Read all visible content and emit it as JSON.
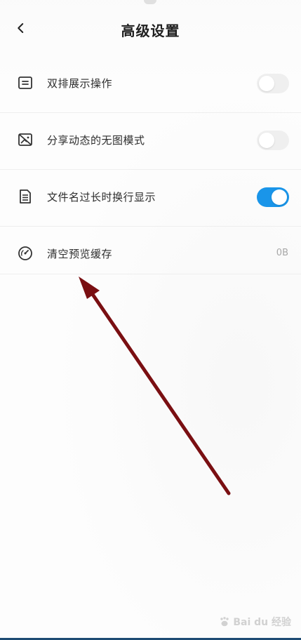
{
  "header": {
    "title": "高级设置",
    "back_icon": "chevron-left-icon"
  },
  "settings": [
    {
      "id": "dual-row-actions",
      "label": "双排展示操作",
      "icon": "list-box-icon",
      "control": "toggle",
      "enabled": false
    },
    {
      "id": "no-image-share",
      "label": "分享动态的无图模式",
      "icon": "no-image-icon",
      "control": "toggle",
      "enabled": false
    },
    {
      "id": "wrap-long-filename",
      "label": "文件名过长时换行显示",
      "icon": "document-icon",
      "control": "toggle",
      "enabled": true
    },
    {
      "id": "clear-preview-cache",
      "label": "清空预览缓存",
      "icon": "gauge-icon",
      "control": "value",
      "value": "0B"
    }
  ],
  "colors": {
    "toggle_on": "#1a95e9",
    "toggle_off": "#efefef",
    "annotation_arrow": "#7a0f12"
  },
  "watermark": {
    "icon": "baidu-paw-icon",
    "text": "Bai du 经验"
  }
}
